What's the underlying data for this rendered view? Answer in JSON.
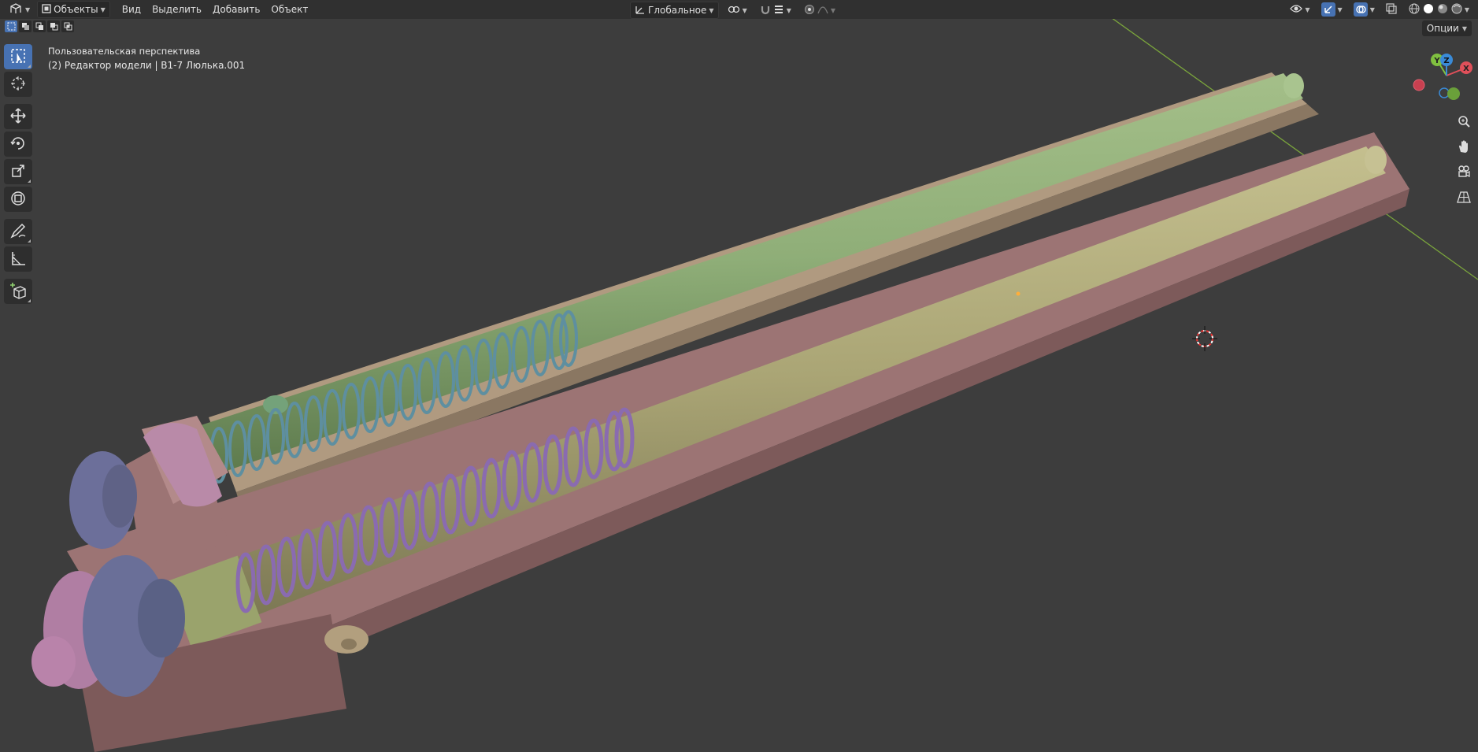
{
  "header": {
    "mode_label": "Объекты",
    "menus": [
      "Вид",
      "Выделить",
      "Добавить",
      "Объект"
    ],
    "transform_orientation": "Глобальное"
  },
  "options_label": "Опции",
  "viewport": {
    "view_name": "Пользовательская перспектива",
    "info_line": "(2) Редактор модели | B1-7 Люлька.001"
  },
  "toolbar": {
    "tools": [
      "select-box",
      "cursor",
      "move",
      "rotate",
      "scale",
      "transform",
      "annotate",
      "measure",
      "add-cube"
    ],
    "active": "select-box"
  },
  "gizmo": {
    "axes": [
      "X",
      "Y",
      "Z"
    ]
  },
  "nav_buttons": [
    "zoom",
    "pan",
    "camera",
    "perspective-toggle"
  ],
  "colors": {
    "accent": "#4772b3",
    "header_bg": "#303030",
    "viewport_bg": "#3d3d3d",
    "axis_x": "#e0505a",
    "axis_y": "#80c040",
    "axis_z": "#3a8bd8"
  }
}
